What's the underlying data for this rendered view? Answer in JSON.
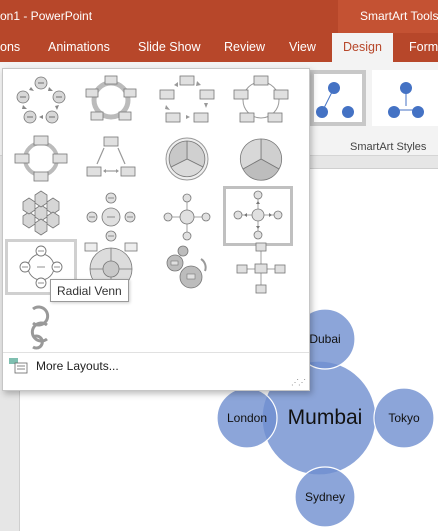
{
  "window": {
    "title": "on1  -  PowerPoint",
    "contextual_tab_group": "SmartArt Tools"
  },
  "ribbon_tabs": [
    {
      "label": "ons"
    },
    {
      "label": "Animations"
    },
    {
      "label": "Slide Show"
    },
    {
      "label": "Review"
    },
    {
      "label": "View"
    },
    {
      "label": "Design",
      "active": true
    },
    {
      "label": "Forma"
    }
  ],
  "ribbon": {
    "group_label": "SmartArt Styles"
  },
  "layout_gallery": {
    "items": [
      {
        "name": "Basic Cycle"
      },
      {
        "name": "Continuous Cycle"
      },
      {
        "name": "Block Cycle"
      },
      {
        "name": "Nondirectional Cycle"
      },
      {
        "name": "Segmented Cycle"
      },
      {
        "name": "Multidirectional Cycle"
      },
      {
        "name": "Cycle Matrix"
      },
      {
        "name": "Basic Pie"
      },
      {
        "name": "Hexagon Radial"
      },
      {
        "name": "Basic Radial"
      },
      {
        "name": "Radial Cluster"
      },
      {
        "name": "Diverging Radial",
        "selected": true
      },
      {
        "name": "Radial Venn",
        "hovered": true
      },
      {
        "name": "Radial Cycle"
      },
      {
        "name": "Gear"
      },
      {
        "name": "Multidirectional Radial"
      },
      {
        "name": "Converging Radial"
      }
    ],
    "more_layouts": "More Layouts...",
    "tooltip": "Radial Venn"
  },
  "diagram": {
    "center": "Mumbai",
    "nodes": [
      "Dubai",
      "London",
      "Tokyo",
      "Sydney"
    ],
    "fill_color": "#6f8fcf"
  },
  "colors": {
    "accent": "#b7472a",
    "smartart_blue": "#4472c4"
  }
}
